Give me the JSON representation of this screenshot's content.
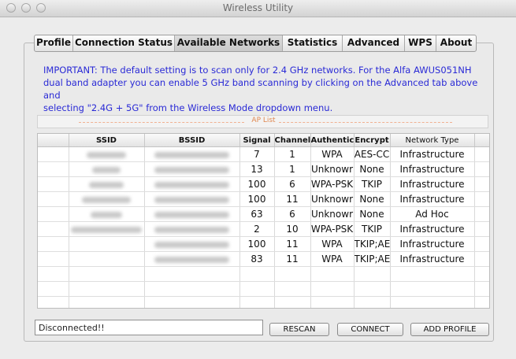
{
  "window": {
    "title": "Wireless Utility"
  },
  "tabs": [
    {
      "label": "Profile"
    },
    {
      "label": "Connection Status"
    },
    {
      "label": "Available Networks",
      "active": true
    },
    {
      "label": "Statistics"
    },
    {
      "label": "Advanced"
    },
    {
      "label": "WPS"
    },
    {
      "label": "About"
    }
  ],
  "notice": {
    "line1": "IMPORTANT: The default setting is to scan only for 2.4 GHz networks. For the Alfa AWUS051NH",
    "line2": "dual band adapter you can enable 5 GHz band scanning by clicking on the Advanced tab above and",
    "line3": "selecting \"2.4G + 5G\" from the Wireless Mode dropdown menu."
  },
  "ap_list": {
    "label": "AP List",
    "columns": [
      "",
      "SSID",
      "BSSID",
      "Signal",
      "Channel",
      "Authentic",
      "Encrypt",
      "Network Type"
    ],
    "rows": [
      {
        "signal": "7",
        "channel": "1",
        "auth": "WPA",
        "encrypt": "AES-CC",
        "type": "Infrastructure"
      },
      {
        "signal": "13",
        "channel": "1",
        "auth": "Unknowr",
        "encrypt": "None",
        "type": "Infrastructure"
      },
      {
        "signal": "100",
        "channel": "6",
        "auth": "WPA-PSK",
        "encrypt": "TKIP",
        "type": "Infrastructure"
      },
      {
        "signal": "100",
        "channel": "11",
        "auth": "Unknowr",
        "encrypt": "None",
        "type": "Infrastructure"
      },
      {
        "signal": "63",
        "channel": "6",
        "auth": "Unknowr",
        "encrypt": "None",
        "type": "Ad Hoc"
      },
      {
        "signal": "2",
        "channel": "10",
        "auth": "WPA-PSK",
        "encrypt": "TKIP",
        "type": "Infrastructure"
      },
      {
        "signal": "100",
        "channel": "11",
        "auth": "WPA",
        "encrypt": "TKIP;AE",
        "type": "Infrastructure"
      },
      {
        "signal": "83",
        "channel": "11",
        "auth": "WPA",
        "encrypt": "TKIP;AE",
        "type": "Infrastructure"
      }
    ]
  },
  "status": {
    "text": "Disconnected!!"
  },
  "buttons": {
    "rescan": "RESCAN",
    "connect": "CONNECT",
    "add_profile": "ADD PROFILE"
  }
}
